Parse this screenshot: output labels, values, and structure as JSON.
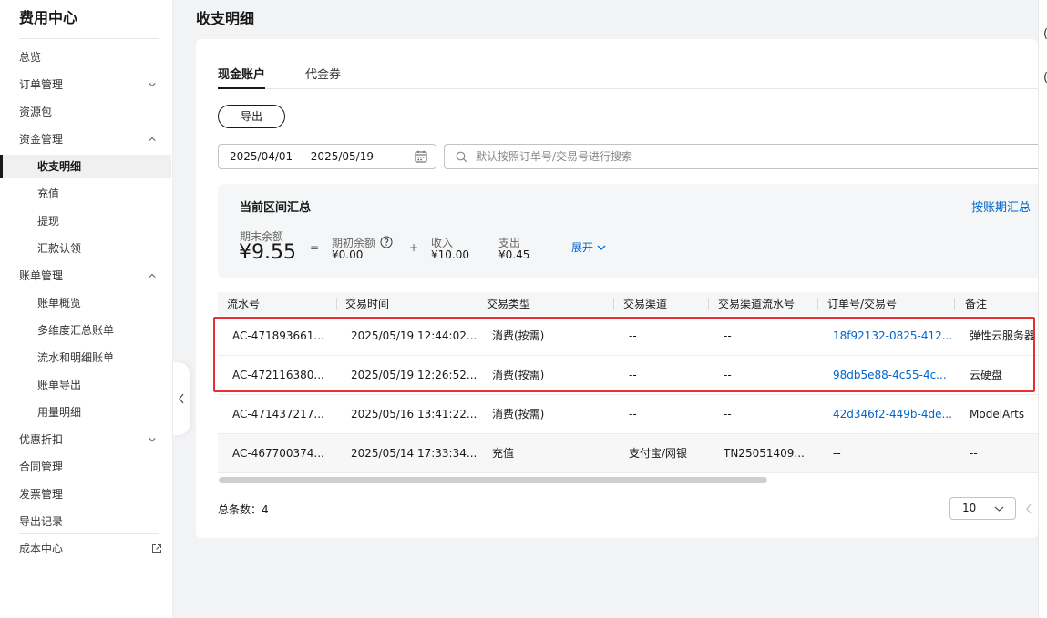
{
  "sidebar": {
    "title": "费用中心",
    "items": [
      {
        "label": "总览"
      },
      {
        "label": "订单管理"
      },
      {
        "label": "资源包"
      },
      {
        "label": "资金管理"
      },
      {
        "label": "收支明细"
      },
      {
        "label": "充值"
      },
      {
        "label": "提现"
      },
      {
        "label": "汇款认领"
      },
      {
        "label": "账单管理"
      },
      {
        "label": "账单概览"
      },
      {
        "label": "多维度汇总账单"
      },
      {
        "label": "流水和明细账单"
      },
      {
        "label": "账单导出"
      },
      {
        "label": "用量明细"
      },
      {
        "label": "优惠折扣"
      },
      {
        "label": "合同管理"
      },
      {
        "label": "发票管理"
      },
      {
        "label": "导出记录"
      },
      {
        "label": "成本中心"
      }
    ]
  },
  "page": {
    "title": "收支明细",
    "tabs": [
      "现金账户",
      "代金券"
    ],
    "export_label": "导出",
    "date_range": "2025/04/01 — 2025/05/19",
    "search_placeholder": "默认按照订单号/交易号进行搜索"
  },
  "summary": {
    "title": "当前区间汇总",
    "link": "按账期汇总",
    "ending_label": "期末余额",
    "ending_value": "¥9.55",
    "eq": "=",
    "opening_label": "期初余额",
    "opening_value": "¥0.00",
    "plus": "+",
    "income_label": "收入",
    "income_value": "¥10.00",
    "minus": "-",
    "expense_label": "支出",
    "expense_value": "¥0.45",
    "expand": "展开"
  },
  "table": {
    "headers": [
      "流水号",
      "交易时间",
      "交易类型",
      "交易渠道",
      "交易渠道流水号",
      "订单号/交易号",
      "备注"
    ],
    "rows": [
      [
        "AC-471893661...",
        "2025/05/19 12:44:02...",
        "消费(按需)",
        "--",
        "--",
        "18f92132-0825-412...",
        "弹性云服务器"
      ],
      [
        "AC-472116380...",
        "2025/05/19 12:26:52...",
        "消费(按需)",
        "--",
        "--",
        "98db5e88-4c55-4c...",
        "云硬盘"
      ],
      [
        "AC-471437217...",
        "2025/05/16 13:41:22...",
        "消费(按需)",
        "--",
        "--",
        "42d346f2-449b-4de...",
        "ModelArts"
      ],
      [
        "AC-467700374...",
        "2025/05/14 17:33:34...",
        "充值",
        "支付宝/网银",
        "TN25051409...",
        "--",
        "--"
      ]
    ]
  },
  "footer": {
    "total": "总条数：4",
    "page_size": "10"
  },
  "accent_color": "#0066cc",
  "highlight_color": "#e5312f"
}
